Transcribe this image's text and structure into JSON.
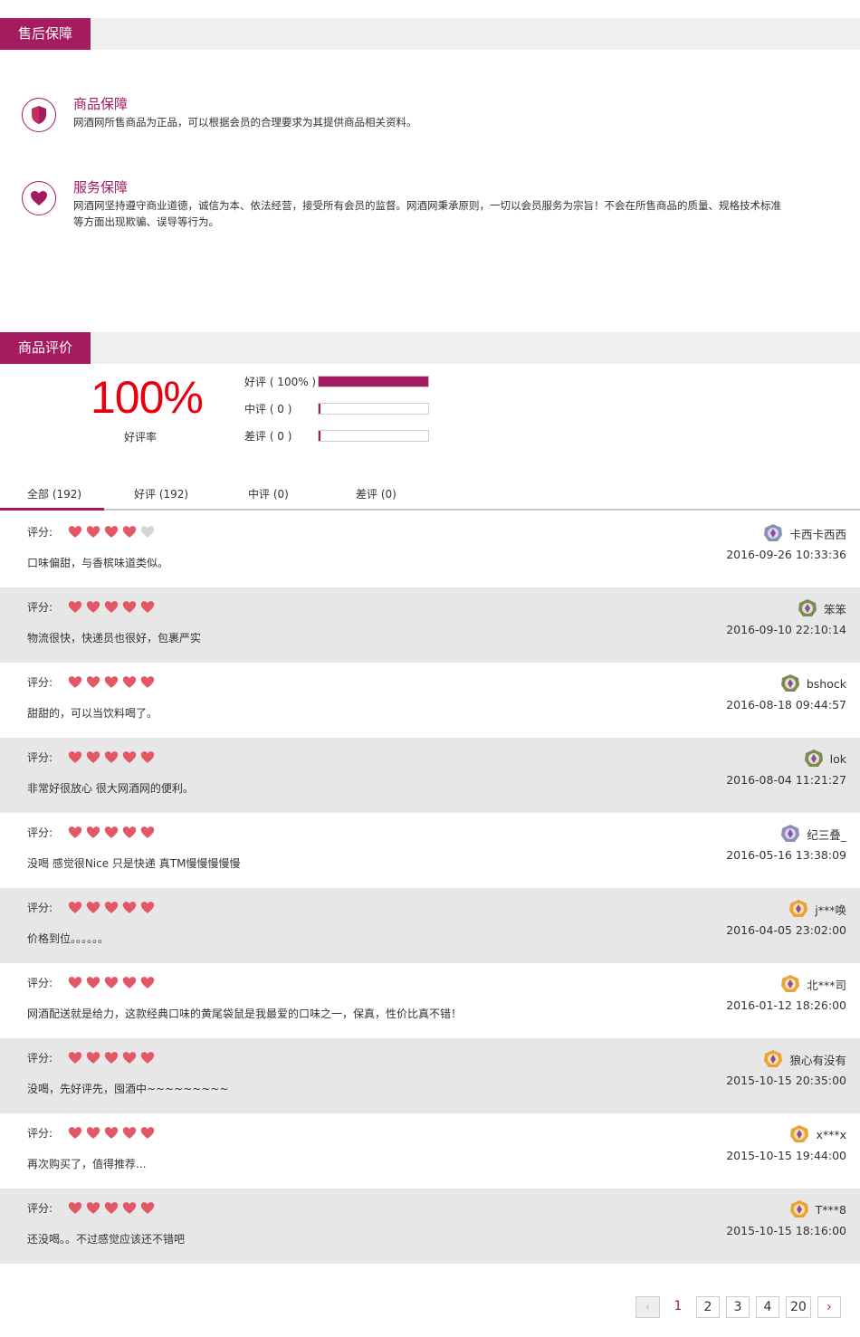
{
  "after_sales": {
    "title": "售后保障",
    "items": [
      {
        "title": "商品保障",
        "desc": "网酒网所售商品为正品，可以根据会员的合理要求为其提供商品相关资料。",
        "icon": "shield-icon"
      },
      {
        "title": "服务保障",
        "desc": "网酒网坚持遵守商业道德，诚信为本、依法经营，接受所有会员的监督。网酒网秉承原则，一切以会员服务为宗旨！不会在所售商品的质量、规格技术标准等方面出现欺骗、误导等行为。",
        "icon": "heart-icon"
      }
    ]
  },
  "reviews_section": {
    "title": "商品评价",
    "rate": "100%",
    "rate_label": "好评率",
    "bars": [
      {
        "label": "好评 ( 100% )",
        "fraction": 1.0
      },
      {
        "label": "中评 ( 0 )",
        "fraction": 0.0
      },
      {
        "label": "差评 ( 0 )",
        "fraction": 0.0
      }
    ],
    "tabs": [
      "全部 (192)",
      "好评 (192)",
      "中评 (0)",
      "差评 (0)"
    ],
    "score_label": "评分:",
    "colors": {
      "accent": "#a41b5f",
      "star_on": "#e35866",
      "star_off": "#d5d5d5",
      "rate": "#e8000f"
    }
  },
  "reviews": [
    {
      "stars": 4,
      "comment": "口味偏甜，与香槟味道类似。",
      "user": "卡西卡西西",
      "date": "2016-09-26 10:33:36",
      "badge": "silver"
    },
    {
      "stars": 5,
      "comment": "物流很快，快递员也很好，包裹严实",
      "user": "笨笨",
      "date": "2016-09-10 22:10:14",
      "badge": "green"
    },
    {
      "stars": 5,
      "comment": "甜甜的，可以当饮料喝了。",
      "user": "bshock",
      "date": "2016-08-18 09:44:57",
      "badge": "green"
    },
    {
      "stars": 5,
      "comment": "非常好很放心 很大网酒网的便利。",
      "user": "lok",
      "date": "2016-08-04 11:21:27",
      "badge": "green"
    },
    {
      "stars": 5,
      "comment": "没喝 感觉很Nice 只是快递 真TM慢慢慢慢慢",
      "user": "纪三叠_",
      "date": "2016-05-16 13:38:09",
      "badge": "silver"
    },
    {
      "stars": 5,
      "comment": "价格到位。。。。。。",
      "user": "j***唤",
      "date": "2016-04-05 23:02:00",
      "badge": "gold"
    },
    {
      "stars": 5,
      "comment": "网酒配送就是给力，这款经典口味的黄尾袋鼠是我最爱的口味之一，保真，性价比真不错！",
      "user": "北***司",
      "date": "2016-01-12 18:26:00",
      "badge": "gold"
    },
    {
      "stars": 5,
      "comment": "没喝，先好评先，囤酒中~~~~~~~~~",
      "user": "狼心有没有",
      "date": "2015-10-15 20:35:00",
      "badge": "gold"
    },
    {
      "stars": 5,
      "comment": "再次购买了，值得推荐...",
      "user": "x***x",
      "date": "2015-10-15 19:44:00",
      "badge": "gold"
    },
    {
      "stars": 5,
      "comment": "还没喝。。不过感觉应该还不错吧",
      "user": "T***8",
      "date": "2015-10-15 18:16:00",
      "badge": "gold"
    }
  ],
  "pager": {
    "prev": "‹",
    "pages": [
      "1",
      "2",
      "3",
      "4",
      "20"
    ],
    "current": "1",
    "next": "›"
  }
}
